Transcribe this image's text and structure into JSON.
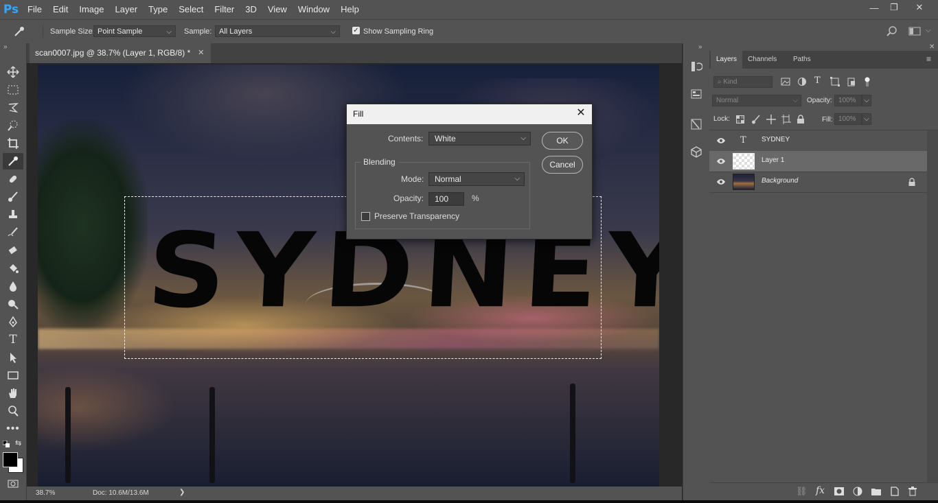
{
  "app": {
    "logo": "Ps"
  },
  "menu": [
    "File",
    "Edit",
    "Image",
    "Layer",
    "Type",
    "Select",
    "Filter",
    "3D",
    "View",
    "Window",
    "Help"
  ],
  "window_controls": {
    "minimize": "—",
    "restore": "❐",
    "close": "✕"
  },
  "options_bar": {
    "sample_size_label": "Sample Size:",
    "sample_size_value": "Point Sample",
    "sample_label": "Sample:",
    "sample_value": "All Layers",
    "show_sampling_ring": "Show Sampling Ring",
    "show_sampling_ring_checked": true
  },
  "document": {
    "tab_title": "scan0007.jpg @ 38.7% (Layer 1, RGB/8) *",
    "tab_close": "✕",
    "canvas_text": "SYDNEY"
  },
  "status_bar": {
    "zoom": "38.7%",
    "doc": "Doc: 10.6M/13.6M",
    "arrow": "❯"
  },
  "fill_dialog": {
    "title": "Fill",
    "close": "✕",
    "contents_label": "Contents:",
    "contents_value": "White",
    "blending_label": "Blending",
    "mode_label": "Mode:",
    "mode_value": "Normal",
    "opacity_label": "Opacity:",
    "opacity_value": "100",
    "opacity_unit": "%",
    "preserve_transparency": "Preserve Transparency",
    "preserve_transparency_checked": false,
    "ok": "OK",
    "cancel": "Cancel"
  },
  "layers_panel": {
    "tabs": [
      "Layers",
      "Channels",
      "Paths"
    ],
    "kind_placeholder": "Kind",
    "blend_mode": "Normal",
    "opacity_label": "Opacity:",
    "opacity_value": "100%",
    "lock_label": "Lock:",
    "fill_label": "Fill:",
    "fill_value": "100%",
    "layers": [
      {
        "name": "SYDNEY",
        "type": "text",
        "selected": false
      },
      {
        "name": "Layer 1",
        "type": "pixel",
        "selected": true
      },
      {
        "name": "Background",
        "type": "background",
        "selected": false,
        "locked": true
      }
    ],
    "type_layer_glyph": "T",
    "collapse_glyph": "»",
    "menu_glyph": "≡"
  },
  "colors": {
    "ui_gray": "#535353",
    "panel_dark": "#424242",
    "ps_blue": "#31a8ff",
    "selected_row": "#696969"
  }
}
